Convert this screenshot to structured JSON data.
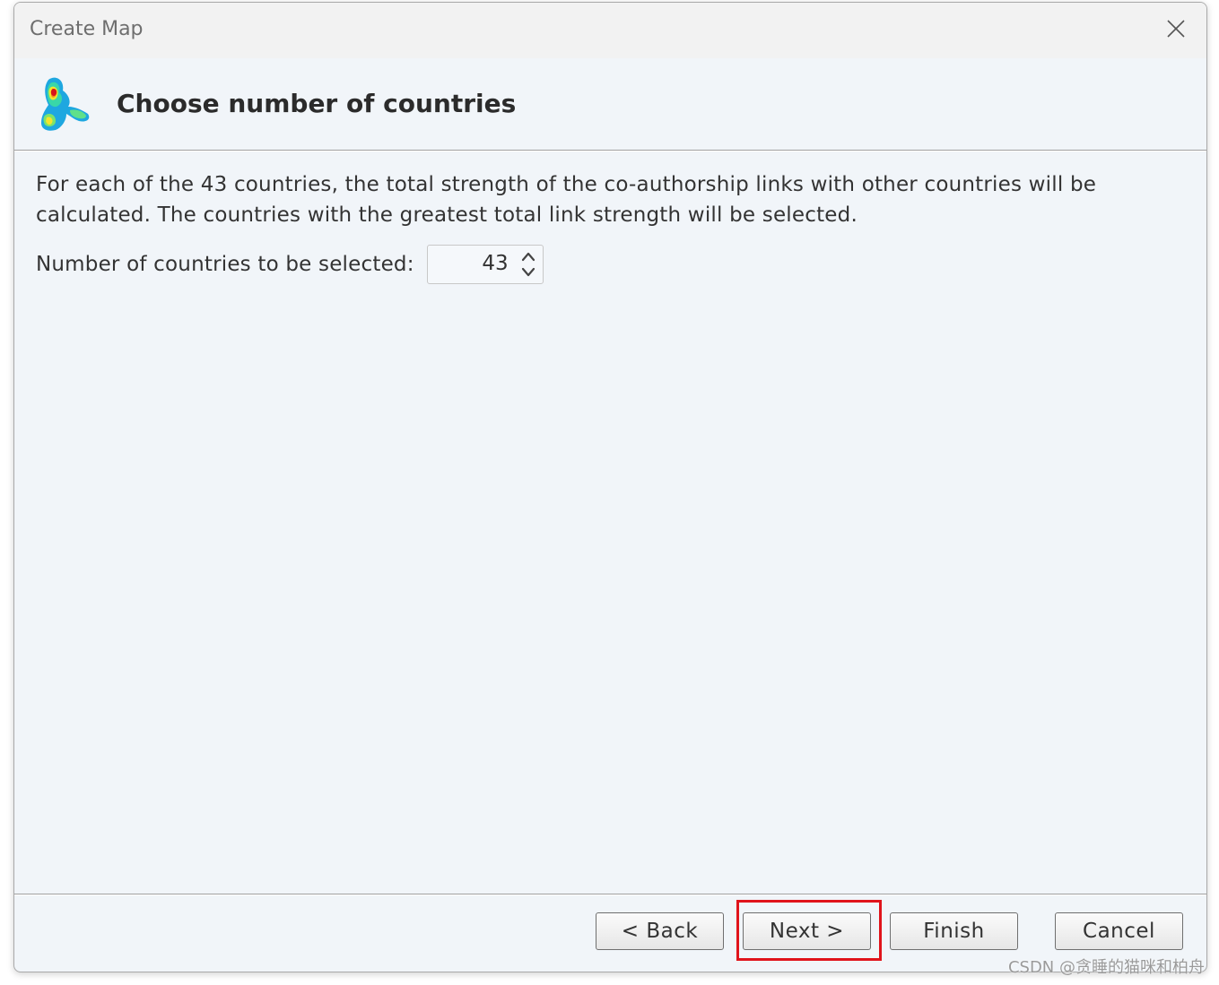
{
  "window": {
    "title": "Create Map"
  },
  "header": {
    "heading": "Choose number of countries"
  },
  "content": {
    "description_line1": "For each of the 43 countries, the total strength of the co-authorship links with other countries will be",
    "description_line2": "calculated. The countries with the greatest total link strength will be selected.",
    "spinner_label": "Number of countries to be selected:",
    "spinner_value": "43"
  },
  "buttons": {
    "back": "< Back",
    "next": "Next >",
    "finish": "Finish",
    "cancel": "Cancel"
  },
  "watermark": "CSDN @贪睡的猫咪和柏舟",
  "colors": {
    "highlight": "#e0141c",
    "background": "#f1f5f9"
  },
  "icons": {
    "close": "close-icon",
    "logo": "vosviewer-logo-icon",
    "spinner_up": "chevron-up-icon",
    "spinner_down": "chevron-down-icon"
  }
}
